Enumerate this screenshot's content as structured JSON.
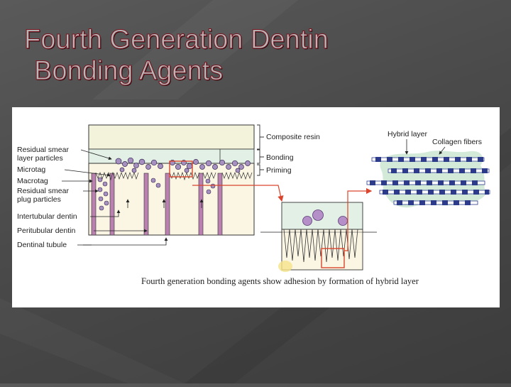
{
  "slide": {
    "title_line1": "Fourth Generation Dentin",
    "title_line2": "Bonding Agents"
  },
  "figure": {
    "left_labels": [
      "Residual smear",
      "layer particles",
      "Microtag",
      "Macrotag",
      "Residual smear",
      "plug particles",
      "Intertubular dentin",
      "Peritubular dentin",
      "Dentinal tubule"
    ],
    "layer_labels": [
      "Composite resin",
      "Bonding",
      "Priming"
    ],
    "inset_labels": [
      "Hybrid layer",
      "Collagen fibers"
    ],
    "caption": "Fourth generation bonding agents show adhesion by formation of hybrid layer"
  },
  "colors": {
    "title_fill": "#b8b8b8",
    "title_outline": "#7a1420",
    "composite": "#f3f3dc",
    "bonding": "#e2f0e6",
    "dentin": "#fbf6e4",
    "tubule": "#b980b0",
    "particle": "#a590c0",
    "highlight": "#d9452d",
    "collagen_blue": "#2d3b8c"
  }
}
